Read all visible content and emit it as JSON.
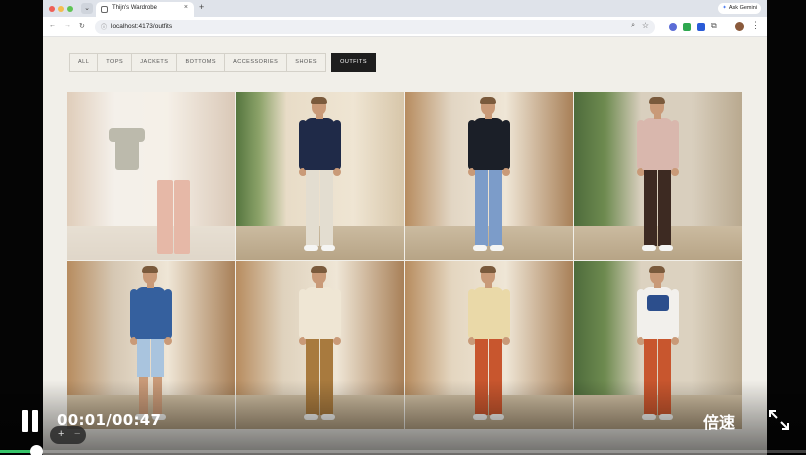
{
  "browser": {
    "tab_title": "Thijn's Wardrobe",
    "tab_close": "×",
    "new_tab": "+",
    "gemini_label": "Ask Gemini",
    "url": "localhost:4173/outfits",
    "nav": {
      "back": "←",
      "forward": "→",
      "reload": "↻"
    },
    "menu": "⋮"
  },
  "filters": [
    {
      "label": "All",
      "active": false
    },
    {
      "label": "Tops",
      "active": false
    },
    {
      "label": "Jackets",
      "active": false
    },
    {
      "label": "Bottoms",
      "active": false
    },
    {
      "label": "Accessories",
      "active": false
    },
    {
      "label": "Shoes",
      "active": false
    },
    {
      "label": "Outfits",
      "active": true
    }
  ],
  "outfits": [
    {
      "scene": "flat-lay",
      "top": "#5b5a3c",
      "bottom": "#c8562e",
      "background": "#ece6dc",
      "faded": true
    },
    {
      "scene": "courtyard",
      "top": "#1f2a48",
      "bottom": "#e3ddd0",
      "background": "#e8dcc7"
    },
    {
      "scene": "interior",
      "top": "#1b1f28",
      "bottom": "#7c9cc9",
      "background": "#e2d6c4"
    },
    {
      "scene": "garden",
      "top": "#d9b7ad",
      "bottom": "#3d2a22",
      "background": "#d9cfbe"
    },
    {
      "scene": "interior",
      "top": "#35609e",
      "bottom": "#a9c4de",
      "background": "#d6c8b4",
      "shorts": true
    },
    {
      "scene": "interior",
      "top": "#efe6d4",
      "bottom": "#a87a3e",
      "background": "#dfd2bd"
    },
    {
      "scene": "interior",
      "top": "#ead9a8",
      "bottom": "#c8562e",
      "background": "#e4d6c0"
    },
    {
      "scene": "garden",
      "top": "#f2f0ec",
      "bottom": "#c8562e",
      "background": "#dcd2c0",
      "graphic": true
    }
  ],
  "player": {
    "time": "00:01/00:47",
    "speed_label": "倍速",
    "progress": 0.04,
    "zoom_plus": "+",
    "zoom_minus": "−"
  },
  "colors": {
    "accent": "#1e1e1e",
    "page_bg": "#f1efe9",
    "progress": "#37c46a"
  }
}
